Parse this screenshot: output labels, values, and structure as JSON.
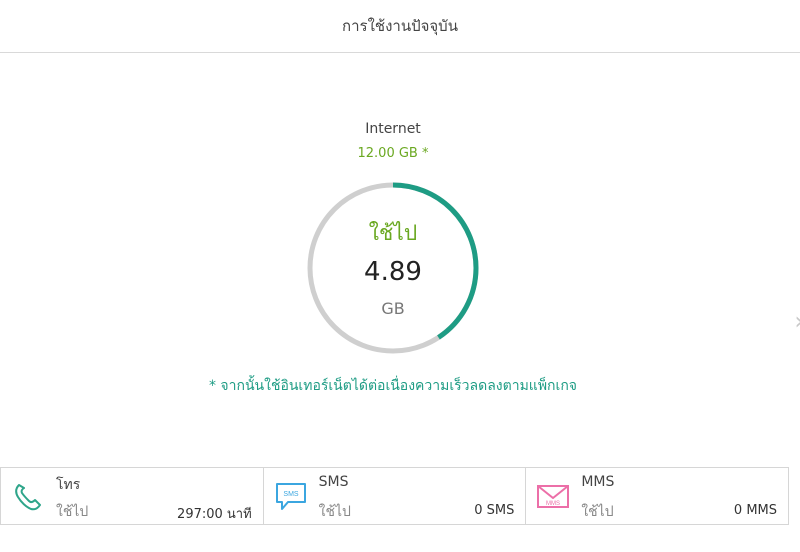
{
  "header": {
    "title": "การใช้งานปัจจุบัน"
  },
  "internet": {
    "label": "Internet",
    "quota": "12.00 GB *",
    "used_label": "ใช้ไป",
    "used_value": "4.89",
    "used_unit": "GB",
    "used_fraction": 0.4075,
    "colors": {
      "used": "#1e9c84",
      "remaining": "#cfcfcf",
      "accent": "#6aa821"
    },
    "note": "* จากนั้นใช้อินเทอร์เน็ตได้ต่อเนื่องความเร็วลดลงตามแพ็กเกจ"
  },
  "services": [
    {
      "name": "โทร",
      "used_label": "ใช้ไป",
      "value": "297:00 นาที",
      "icon": "phone-icon"
    },
    {
      "name": "SMS",
      "used_label": "ใช้ไป",
      "value": "0 SMS",
      "icon": "sms-icon"
    },
    {
      "name": "MMS",
      "used_label": "ใช้ไป",
      "value": "0 MMS",
      "icon": "mms-icon"
    }
  ],
  "nav": {
    "next_icon": "chevron-right-icon"
  }
}
